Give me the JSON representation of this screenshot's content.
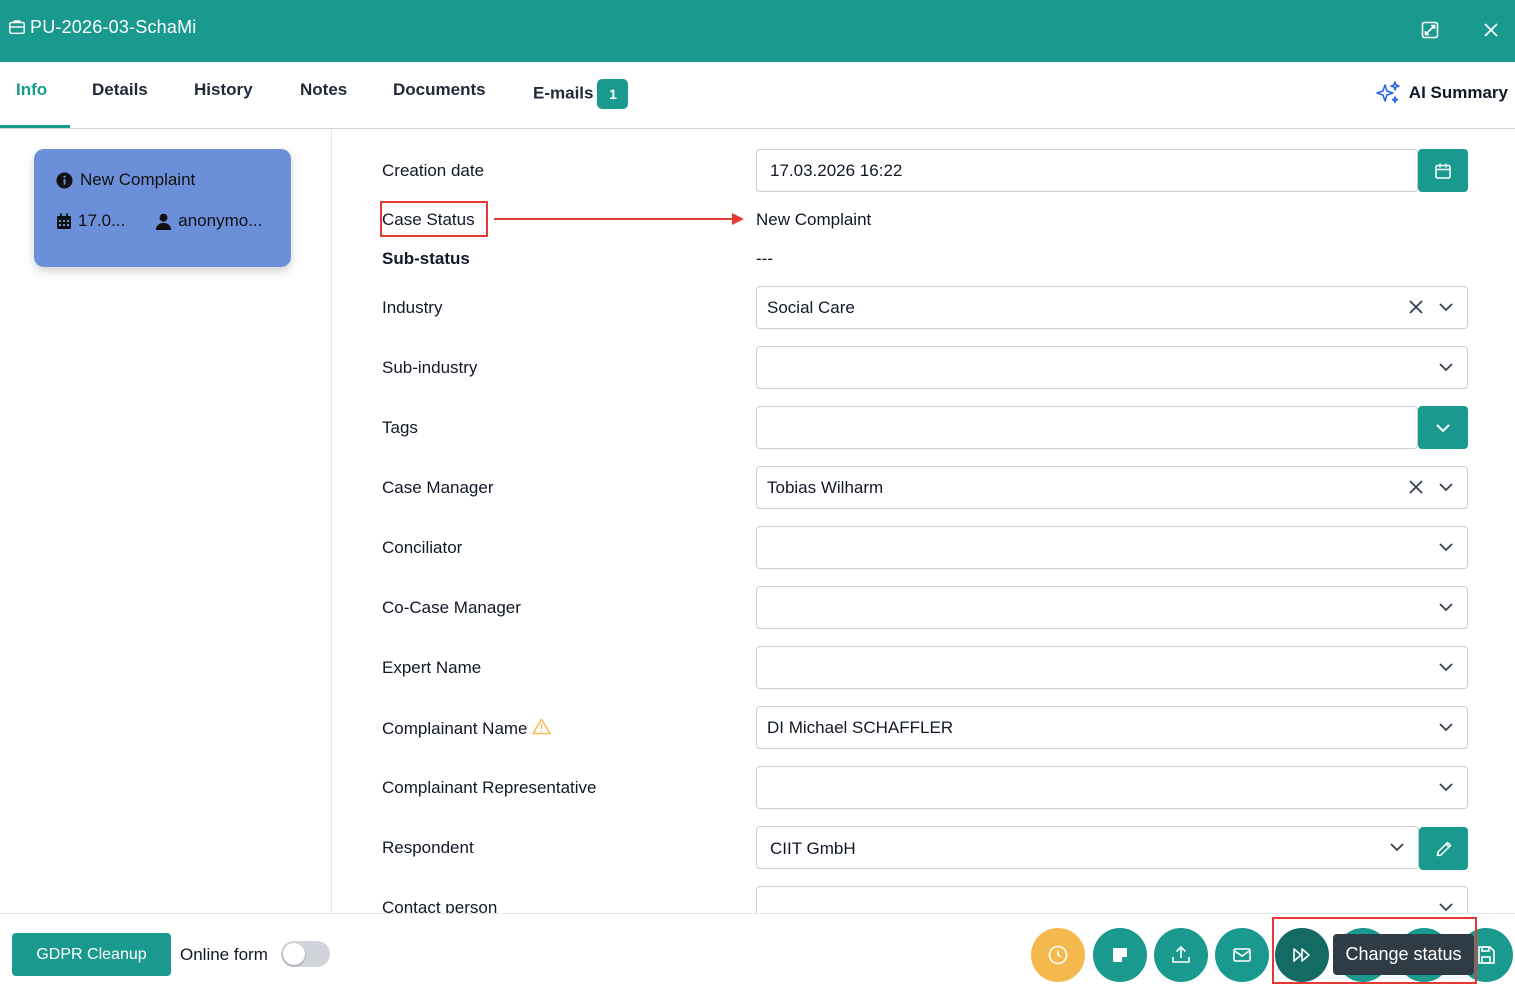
{
  "window": {
    "case_id": "PU-2026-03-SchaMi",
    "icons": [
      "briefcase-icon",
      "expand-icon",
      "close-icon"
    ]
  },
  "tabs": [
    {
      "label": "Info",
      "active": true
    },
    {
      "label": "Details"
    },
    {
      "label": "History"
    },
    {
      "label": "Notes"
    },
    {
      "label": "Documents"
    },
    {
      "label": "E-mails",
      "badge": "1"
    }
  ],
  "ai_summary": {
    "label": "AI Summary",
    "icon": "sparkle-icon"
  },
  "status_card": {
    "status": "New Complaint",
    "date": "17.0...",
    "user": "anonymo...",
    "color": "#6b8fd8"
  },
  "form": {
    "creation_date": {
      "label": "Creation date",
      "value": "17.03.2026 16:22"
    },
    "case_status": {
      "label": "Case Status",
      "value": "New Complaint"
    },
    "sub_status": {
      "label": "Sub-status",
      "value": "---"
    },
    "industry": {
      "label": "Industry",
      "value": "Social Care"
    },
    "sub_industry": {
      "label": "Sub-industry",
      "value": ""
    },
    "tags": {
      "label": "Tags",
      "value": ""
    },
    "case_manager": {
      "label": "Case Manager",
      "value": "Tobias Wilharm"
    },
    "conciliator": {
      "label": "Conciliator",
      "value": ""
    },
    "co_case_manager": {
      "label": "Co-Case Manager",
      "value": ""
    },
    "expert_name": {
      "label": "Expert Name",
      "value": ""
    },
    "complainant_name": {
      "label": "Complainant Name",
      "value": "DI Michael SCHAFFLER",
      "warning": true
    },
    "complainant_representative": {
      "label": "Complainant Representative",
      "value": ""
    },
    "respondent": {
      "label": "Respondent",
      "value": "CIIT GmbH"
    },
    "contact_person": {
      "label": "Contact person",
      "value": ""
    }
  },
  "footer": {
    "gdpr_button": "GDPR Cleanup",
    "online_form_label": "Online form",
    "online_form_on": false,
    "tooltip": "Change status"
  },
  "colors": {
    "primary": "#1a9a8f",
    "warning": "#f5b84c",
    "annotation": "#e53935",
    "tooltip": "#2f3b45"
  }
}
